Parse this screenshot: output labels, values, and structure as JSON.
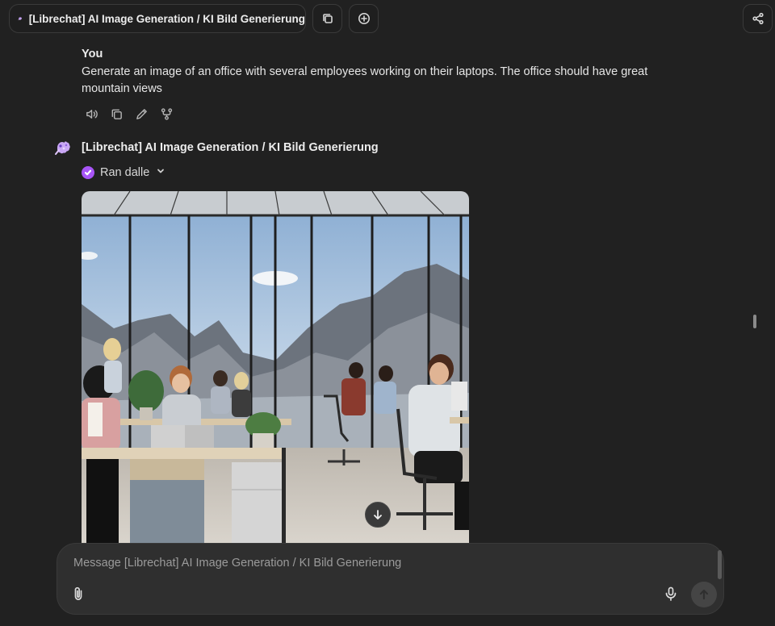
{
  "header": {
    "agent_title": "[Librechat] AI Image Generation / KI Bild Generierung",
    "avatar_icon": "brain-palette-avatar-icon",
    "copy_icon": "copy-chat-icon",
    "new_chat_icon": "plus-circle-icon",
    "share_icon": "share-icon"
  },
  "user_message": {
    "author": "You",
    "text": "Generate an image of an office with several employees working on their laptops. The office should have great mountain views",
    "actions": [
      "speaker-icon",
      "copy-icon",
      "edit-icon",
      "fork-icon"
    ]
  },
  "assistant_message": {
    "author": "[Librechat] AI Image Generation / KI Bild Generierung",
    "tool_call": {
      "label": "Ran dalle",
      "status_color": "#a855f7"
    },
    "image_alt": "Generated image: modern office with employees at laptops and large windows showing mountain views"
  },
  "composer": {
    "placeholder": "Message [Librechat] AI Image Generation / KI Bild Generierung",
    "attach_icon": "paperclip-icon",
    "mic_icon": "microphone-icon",
    "send_icon": "arrow-up-icon"
  },
  "colors": {
    "background": "#212121",
    "accent": "#a855f7",
    "composer": "#2f2f2f"
  }
}
